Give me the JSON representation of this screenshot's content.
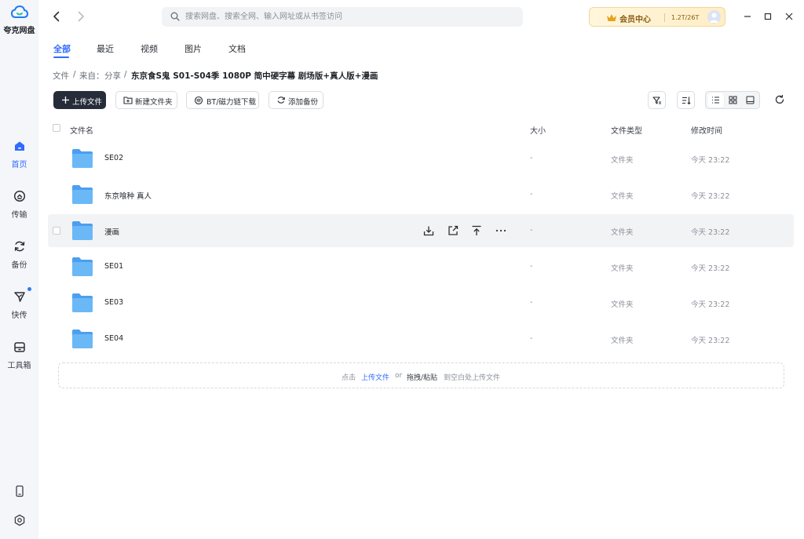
{
  "app": {
    "logo_text": "夸克网盘"
  },
  "sidebar": {
    "items": [
      {
        "label": "首页",
        "icon": "home-icon",
        "active": true
      },
      {
        "label": "传输",
        "icon": "transfer-icon"
      },
      {
        "label": "备份",
        "icon": "backup-icon"
      },
      {
        "label": "快传",
        "icon": "send-icon",
        "has_dot": true
      },
      {
        "label": "工具箱",
        "icon": "toolbox-icon"
      }
    ],
    "bottom": [
      "phone-icon",
      "settings-icon"
    ]
  },
  "search": {
    "placeholder": "搜索网盘、搜索全网、输入网址或从书签访问"
  },
  "vip": {
    "label": "会员中心",
    "quota": "1.2T/26T"
  },
  "tabs": [
    "全部",
    "最近",
    "视频",
    "图片",
    "文档"
  ],
  "breadcrumb": {
    "root": "文件",
    "separator": "/",
    "source_prefix": "来自：",
    "source": "分享",
    "current": "东京食S鬼 S01-S04季 1080P 简中硬字幕 剧场版+真人版+漫画"
  },
  "toolbar": {
    "upload": "上传文件",
    "new_folder": "新建文件夹",
    "bt_download": "BT/磁力链下载",
    "add_backup": "添加备份"
  },
  "table": {
    "headers": {
      "name": "文件名",
      "size": "大小",
      "type": "文件类型",
      "modified": "修改时间"
    },
    "rows": [
      {
        "name": "SE02",
        "size": "-",
        "type": "文件夹",
        "modified": "今天 23:22"
      },
      {
        "name": "东京喰种 真人",
        "size": "-",
        "type": "文件夹",
        "modified": "今天 23:22"
      },
      {
        "name": "漫画",
        "size": "-",
        "type": "文件夹",
        "modified": "今天 23:22",
        "hover": true
      },
      {
        "name": "SE01",
        "size": "-",
        "type": "文件夹",
        "modified": "今天 23:22"
      },
      {
        "name": "SE03",
        "size": "-",
        "type": "文件夹",
        "modified": "今天 23:22"
      },
      {
        "name": "SE04",
        "size": "-",
        "type": "文件夹",
        "modified": "今天 23:22"
      }
    ]
  },
  "dropzone": {
    "prefix": "点击",
    "upload_link": "上传文件",
    "or": "or",
    "drag_link": "拖拽/粘贴",
    "suffix": "到空白处上传文件"
  },
  "colors": {
    "accent": "#2f6bff",
    "primary_button": "#262c3a",
    "folder": "#5fb0f5",
    "vip_text": "#8a5a12"
  }
}
